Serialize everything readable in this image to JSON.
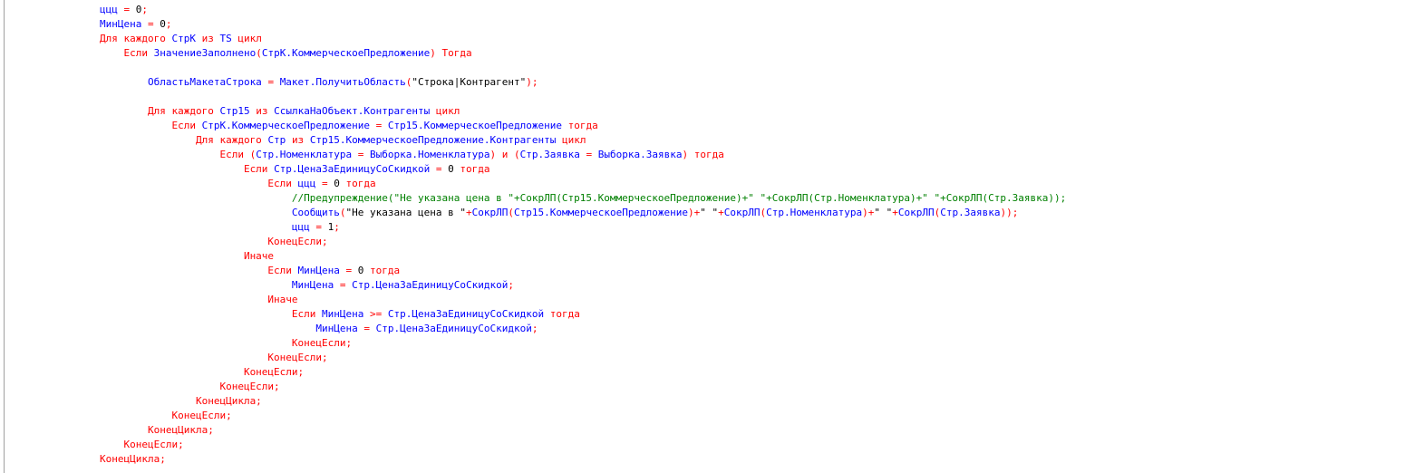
{
  "colors": {
    "keyword": "#ff0000",
    "identifier": "#0000ff",
    "literal": "#000000",
    "comment": "#008000",
    "background": "#ffffff"
  },
  "lines": [
    [
      {
        "c": "id",
        "t": "ццц "
      },
      {
        "c": "op",
        "t": "= "
      },
      {
        "c": "num",
        "t": "0"
      },
      {
        "c": "op",
        "t": ";"
      }
    ],
    [
      {
        "c": "id",
        "t": "МинЦена "
      },
      {
        "c": "op",
        "t": "= "
      },
      {
        "c": "num",
        "t": "0"
      },
      {
        "c": "op",
        "t": ";"
      }
    ],
    [
      {
        "c": "kw",
        "t": "Для каждого "
      },
      {
        "c": "id",
        "t": "СтрК "
      },
      {
        "c": "kw",
        "t": "из "
      },
      {
        "c": "id",
        "t": "TS "
      },
      {
        "c": "kw",
        "t": "цикл"
      }
    ],
    [
      {
        "c": "kw",
        "t": "    Если "
      },
      {
        "c": "id",
        "t": "ЗначениеЗаполнено"
      },
      {
        "c": "op",
        "t": "("
      },
      {
        "c": "id",
        "t": "СтрК.КоммерческоеПредложение"
      },
      {
        "c": "op",
        "t": ") "
      },
      {
        "c": "kw",
        "t": "Тогда"
      }
    ],
    [],
    [
      {
        "c": "id",
        "t": "        ОбластьМакетаСтрока "
      },
      {
        "c": "op",
        "t": "= "
      },
      {
        "c": "id",
        "t": "Макет.ПолучитьОбласть"
      },
      {
        "c": "op",
        "t": "("
      },
      {
        "c": "str",
        "t": "\"Строка|Контрагент\""
      },
      {
        "c": "op",
        "t": ");"
      }
    ],
    [],
    [
      {
        "c": "kw",
        "t": "        Для каждого "
      },
      {
        "c": "id",
        "t": "Стр15 "
      },
      {
        "c": "kw",
        "t": "из "
      },
      {
        "c": "id",
        "t": "СсылкаНаОбъект.Контрагенты "
      },
      {
        "c": "kw",
        "t": "цикл"
      }
    ],
    [
      {
        "c": "kw",
        "t": "            Если "
      },
      {
        "c": "id",
        "t": "СтрК.КоммерческоеПредложение "
      },
      {
        "c": "op",
        "t": "= "
      },
      {
        "c": "id",
        "t": "Стр15.КоммерческоеПредложение "
      },
      {
        "c": "kw",
        "t": "тогда"
      }
    ],
    [
      {
        "c": "kw",
        "t": "                Для каждого "
      },
      {
        "c": "id",
        "t": "Стр "
      },
      {
        "c": "kw",
        "t": "из "
      },
      {
        "c": "id",
        "t": "Стр15.КоммерческоеПредложение.Контрагенты "
      },
      {
        "c": "kw",
        "t": "цикл"
      }
    ],
    [
      {
        "c": "kw",
        "t": "                    Если "
      },
      {
        "c": "op",
        "t": "("
      },
      {
        "c": "id",
        "t": "Стр.Номенклатура "
      },
      {
        "c": "op",
        "t": "= "
      },
      {
        "c": "id",
        "t": "Выборка.Номенклатура"
      },
      {
        "c": "op",
        "t": ") "
      },
      {
        "c": "kw",
        "t": "и "
      },
      {
        "c": "op",
        "t": "("
      },
      {
        "c": "id",
        "t": "Стр.Заявка "
      },
      {
        "c": "op",
        "t": "= "
      },
      {
        "c": "id",
        "t": "Выборка.Заявка"
      },
      {
        "c": "op",
        "t": ") "
      },
      {
        "c": "kw",
        "t": "тогда"
      }
    ],
    [
      {
        "c": "kw",
        "t": "                        Если "
      },
      {
        "c": "id",
        "t": "Стр.ЦенаЗаЕдиницуСоСкидкой "
      },
      {
        "c": "op",
        "t": "= "
      },
      {
        "c": "num",
        "t": "0 "
      },
      {
        "c": "kw",
        "t": "тогда"
      }
    ],
    [
      {
        "c": "kw",
        "t": "                            Если "
      },
      {
        "c": "id",
        "t": "ццц "
      },
      {
        "c": "op",
        "t": "= "
      },
      {
        "c": "num",
        "t": "0 "
      },
      {
        "c": "kw",
        "t": "тогда"
      }
    ],
    [
      {
        "c": "cmt",
        "t": "                                //Предупреждение(\"Не указана цена в \"+СокрЛП(Стр15.КоммерческоеПредложение)+\" \"+СокрЛП(Стр.Номенклатура)+\" \"+СокрЛП(Стр.Заявка));"
      }
    ],
    [
      {
        "c": "id",
        "t": "                                Сообщить"
      },
      {
        "c": "op",
        "t": "("
      },
      {
        "c": "str",
        "t": "\"Не указана цена в \""
      },
      {
        "c": "op",
        "t": "+"
      },
      {
        "c": "id",
        "t": "СокрЛП"
      },
      {
        "c": "op",
        "t": "("
      },
      {
        "c": "id",
        "t": "Стр15.КоммерческоеПредложение"
      },
      {
        "c": "op",
        "t": ")+"
      },
      {
        "c": "str",
        "t": "\" \""
      },
      {
        "c": "op",
        "t": "+"
      },
      {
        "c": "id",
        "t": "СокрЛП"
      },
      {
        "c": "op",
        "t": "("
      },
      {
        "c": "id",
        "t": "Стр.Номенклатура"
      },
      {
        "c": "op",
        "t": ")+"
      },
      {
        "c": "str",
        "t": "\" \""
      },
      {
        "c": "op",
        "t": "+"
      },
      {
        "c": "id",
        "t": "СокрЛП"
      },
      {
        "c": "op",
        "t": "("
      },
      {
        "c": "id",
        "t": "Стр.Заявка"
      },
      {
        "c": "op",
        "t": "));"
      }
    ],
    [
      {
        "c": "id",
        "t": "                                ццц "
      },
      {
        "c": "op",
        "t": "= "
      },
      {
        "c": "num",
        "t": "1"
      },
      {
        "c": "op",
        "t": ";"
      }
    ],
    [
      {
        "c": "kw",
        "t": "                            КонецЕсли;"
      }
    ],
    [
      {
        "c": "kw",
        "t": "                        Иначе"
      }
    ],
    [
      {
        "c": "kw",
        "t": "                            Если "
      },
      {
        "c": "id",
        "t": "МинЦена "
      },
      {
        "c": "op",
        "t": "= "
      },
      {
        "c": "num",
        "t": "0 "
      },
      {
        "c": "kw",
        "t": "тогда"
      }
    ],
    [
      {
        "c": "id",
        "t": "                                МинЦена "
      },
      {
        "c": "op",
        "t": "= "
      },
      {
        "c": "id",
        "t": "Стр.ЦенаЗаЕдиницуСоСкидкой"
      },
      {
        "c": "op",
        "t": ";"
      }
    ],
    [
      {
        "c": "kw",
        "t": "                            Иначе"
      }
    ],
    [
      {
        "c": "kw",
        "t": "                                Если "
      },
      {
        "c": "id",
        "t": "МинЦена "
      },
      {
        "c": "op",
        "t": ">= "
      },
      {
        "c": "id",
        "t": "Стр.ЦенаЗаЕдиницуСоСкидкой "
      },
      {
        "c": "kw",
        "t": "тогда"
      }
    ],
    [
      {
        "c": "id",
        "t": "                                    МинЦена "
      },
      {
        "c": "op",
        "t": "= "
      },
      {
        "c": "id",
        "t": "Стр.ЦенаЗаЕдиницуСоСкидкой"
      },
      {
        "c": "op",
        "t": ";"
      }
    ],
    [
      {
        "c": "kw",
        "t": "                                КонецЕсли;"
      }
    ],
    [
      {
        "c": "kw",
        "t": "                            КонецЕсли;"
      }
    ],
    [
      {
        "c": "kw",
        "t": "                        КонецЕсли;"
      }
    ],
    [
      {
        "c": "kw",
        "t": "                    КонецЕсли;"
      }
    ],
    [
      {
        "c": "kw",
        "t": "                КонецЦикла;"
      }
    ],
    [
      {
        "c": "kw",
        "t": "            КонецЕсли;"
      }
    ],
    [
      {
        "c": "kw",
        "t": "        КонецЦикла;"
      }
    ],
    [
      {
        "c": "kw",
        "t": "    КонецЕсли;"
      }
    ],
    [
      {
        "c": "kw",
        "t": "КонецЦикла;"
      }
    ]
  ]
}
